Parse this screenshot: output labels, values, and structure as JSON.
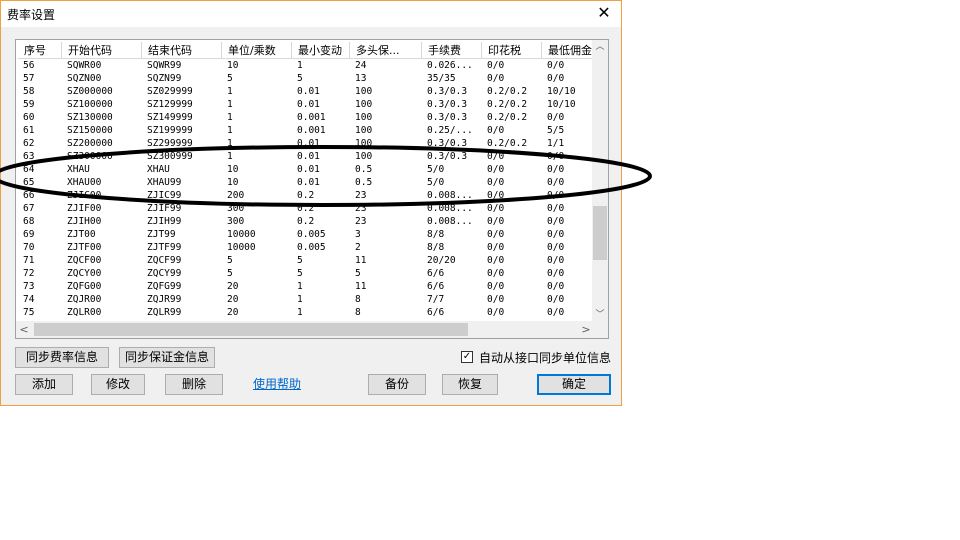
{
  "window": {
    "title": "费率设置",
    "close_symbol": "✕"
  },
  "table": {
    "columns": [
      "序号",
      "开始代码",
      "结束代码",
      "单位/乘数",
      "最小变动",
      "多头保...",
      "手续费",
      "印花税",
      "最低佣金"
    ],
    "rows": [
      [
        "56",
        "SQWR00",
        "SQWR99",
        "10",
        "1",
        "24",
        "0.026...",
        "0/0",
        "0/0"
      ],
      [
        "57",
        "SQZN00",
        "SQZN99",
        "5",
        "5",
        "13",
        "35/35",
        "0/0",
        "0/0"
      ],
      [
        "58",
        "SZ000000",
        "SZ029999",
        "1",
        "0.01",
        "100",
        "0.3/0.3",
        "0.2/0.2",
        "10/10"
      ],
      [
        "59",
        "SZ100000",
        "SZ129999",
        "1",
        "0.01",
        "100",
        "0.3/0.3",
        "0.2/0.2",
        "10/10"
      ],
      [
        "60",
        "SZ130000",
        "SZ149999",
        "1",
        "0.001",
        "100",
        "0.3/0.3",
        "0.2/0.2",
        "0/0"
      ],
      [
        "61",
        "SZ150000",
        "SZ199999",
        "1",
        "0.001",
        "100",
        "0.25/...",
        "0/0",
        "5/5"
      ],
      [
        "62",
        "SZ200000",
        "SZ299999",
        "1",
        "0.01",
        "100",
        "0.3/0.3",
        "0.2/0.2",
        "1/1"
      ],
      [
        "63",
        "SZ300000",
        "SZ300999",
        "1",
        "0.01",
        "100",
        "0.3/0.3",
        "0/0",
        "0/0"
      ],
      [
        "64",
        "XHAU",
        "XHAU",
        "10",
        "0.01",
        "0.5",
        "5/0",
        "0/0",
        "0/0"
      ],
      [
        "65",
        "XHAU00",
        "XHAU99",
        "10",
        "0.01",
        "0.5",
        "5/0",
        "0/0",
        "0/0"
      ],
      [
        "66",
        "ZJIC00",
        "ZJIC99",
        "200",
        "0.2",
        "23",
        "0.008...",
        "0/0",
        "0/0"
      ],
      [
        "67",
        "ZJIF00",
        "ZJIF99",
        "300",
        "0.2",
        "23",
        "0.008...",
        "0/0",
        "0/0"
      ],
      [
        "68",
        "ZJIH00",
        "ZJIH99",
        "300",
        "0.2",
        "23",
        "0.008...",
        "0/0",
        "0/0"
      ],
      [
        "69",
        "ZJT00",
        "ZJT99",
        "10000",
        "0.005",
        "3",
        "8/8",
        "0/0",
        "0/0"
      ],
      [
        "70",
        "ZJTF00",
        "ZJTF99",
        "10000",
        "0.005",
        "2",
        "8/8",
        "0/0",
        "0/0"
      ],
      [
        "71",
        "ZQCF00",
        "ZQCF99",
        "5",
        "5",
        "11",
        "20/20",
        "0/0",
        "0/0"
      ],
      [
        "72",
        "ZQCY00",
        "ZQCY99",
        "5",
        "5",
        "5",
        "6/6",
        "0/0",
        "0/0"
      ],
      [
        "73",
        "ZQFG00",
        "ZQFG99",
        "20",
        "1",
        "11",
        "6/6",
        "0/0",
        "0/0"
      ],
      [
        "74",
        "ZQJR00",
        "ZQJR99",
        "20",
        "1",
        "8",
        "7/7",
        "0/0",
        "0/0"
      ],
      [
        "75",
        "ZQLR00",
        "ZQLR99",
        "20",
        "1",
        "8",
        "6/6",
        "0/0",
        "0/0"
      ]
    ]
  },
  "scrollbar": {
    "up": "︿",
    "down": "﹀",
    "left": "<",
    "right": ">"
  },
  "buttons": {
    "sync_rate": "同步费率信息",
    "sync_margin": "同步保证金信息",
    "add": "添加",
    "edit": "修改",
    "delete": "删除",
    "help": "使用帮助",
    "backup": "备份",
    "restore": "恢复",
    "ok": "确定"
  },
  "checkbox": {
    "label": "自动从接口同步单位信息",
    "checked": true,
    "mark": "✓"
  },
  "colors": {
    "window_border": "#f0a040",
    "dialog_bg": "#f0f0f0",
    "link": "#0066cc",
    "default_button_border": "#0078d7",
    "annotation": "#000000"
  }
}
